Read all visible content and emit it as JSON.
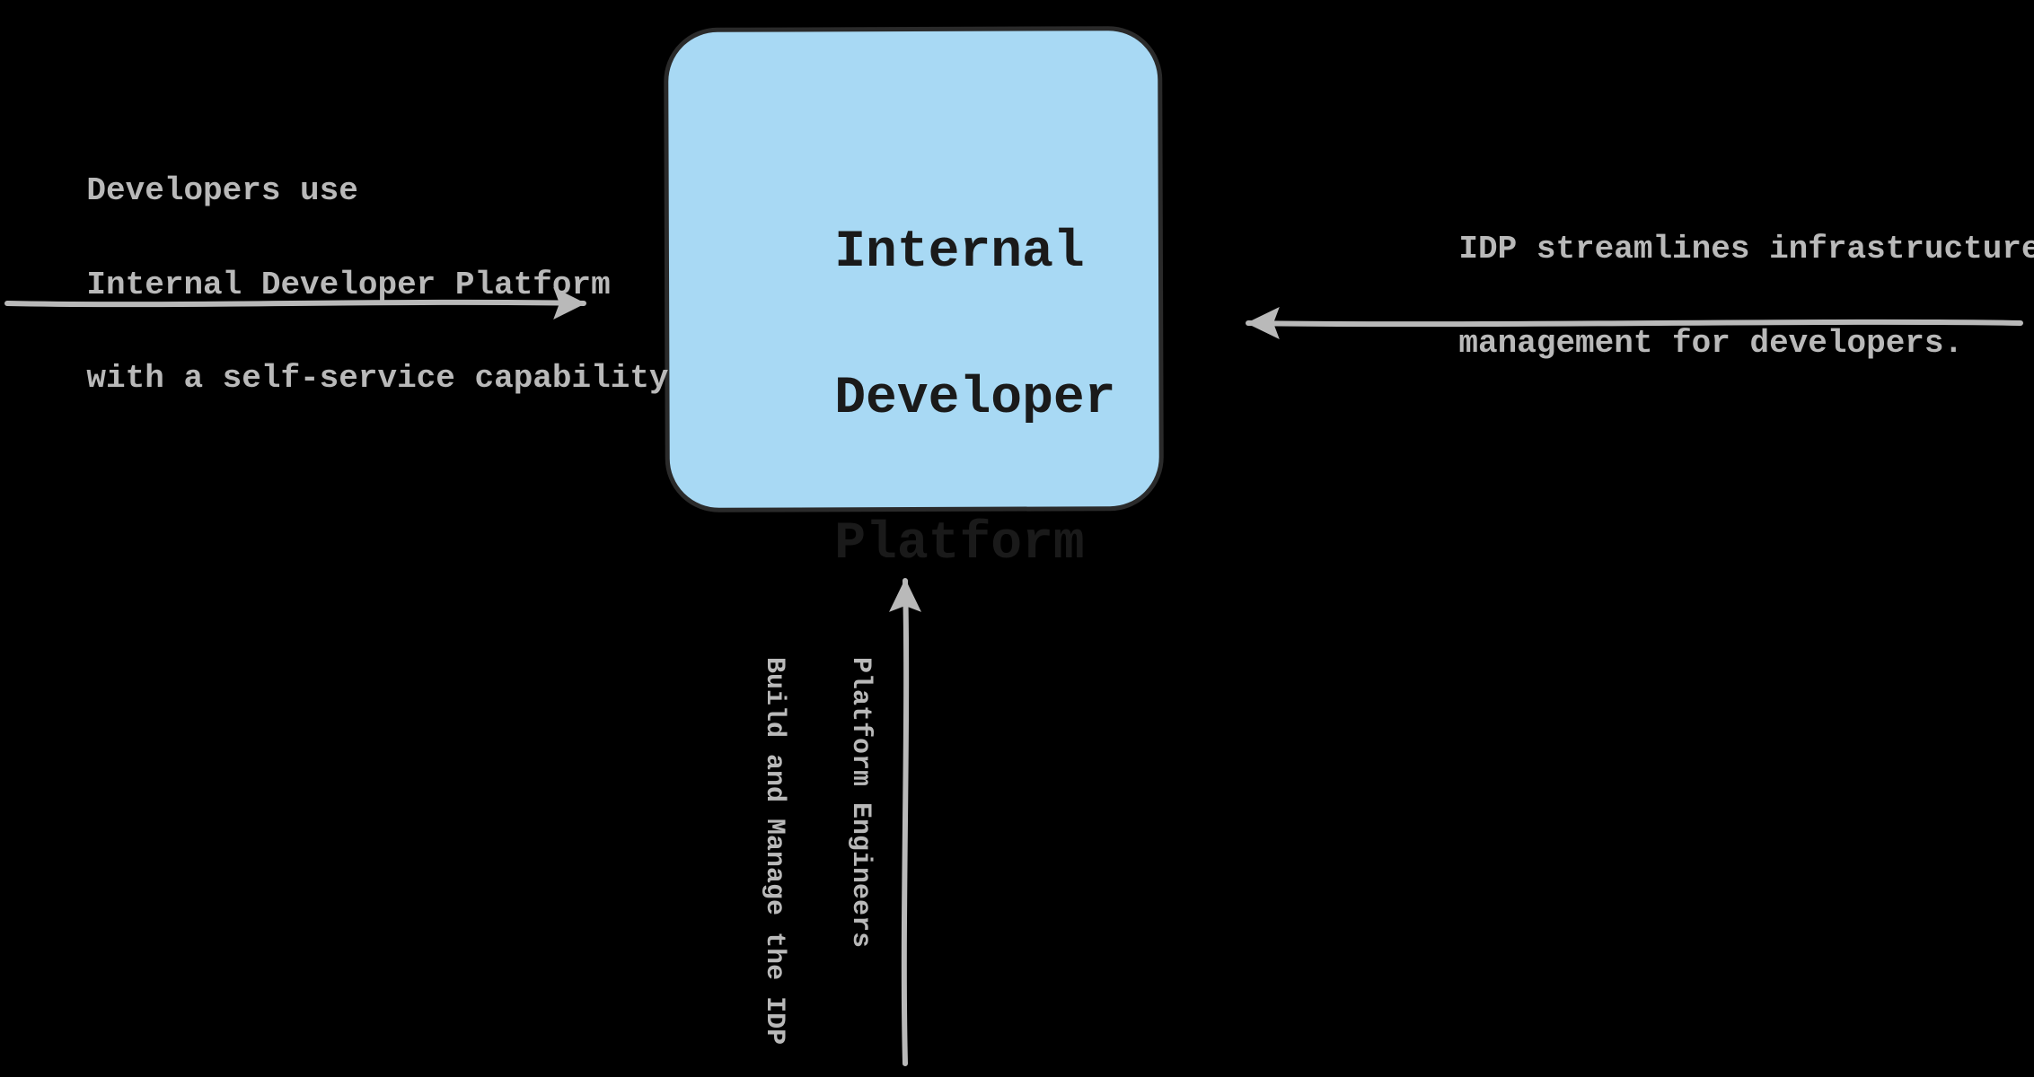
{
  "center": {
    "line1": "Internal",
    "line2": "Developer",
    "line3": "Platform"
  },
  "left_label": {
    "line1": "Developers use",
    "line2": "Internal Developer Platform",
    "line3": "with a self-service capability"
  },
  "right_label": {
    "line1": "IDP streamlines infrastructure",
    "line2": "management for developers."
  },
  "bottom_label": {
    "line1": "Platform Engineers",
    "line2": "Build and Manage the IDP"
  }
}
